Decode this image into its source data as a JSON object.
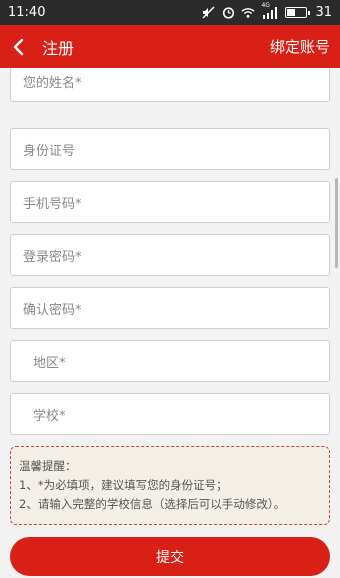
{
  "status_bar": {
    "time": "11:40",
    "network": "4G",
    "battery": "31"
  },
  "header": {
    "title": "注册",
    "action": "绑定账号"
  },
  "form": {
    "name_placeholder": "您的姓名*",
    "id_placeholder": "身份证号",
    "phone_placeholder": "手机号码*",
    "password_placeholder": "登录密码*",
    "confirm_placeholder": "确认密码*",
    "region_placeholder": "地区*",
    "school_placeholder": "学校*"
  },
  "tips": {
    "title": "温馨提醒：",
    "line1": "1、*为必填项，建议填写您的身份证号；",
    "line2": "2、请输入完整的学校信息（选择后可以手动修改）。"
  },
  "submit_label": "提交",
  "colors": {
    "primary": "#d82016",
    "status_bar": "#2b2b2b",
    "background": "#f2f2f2"
  }
}
